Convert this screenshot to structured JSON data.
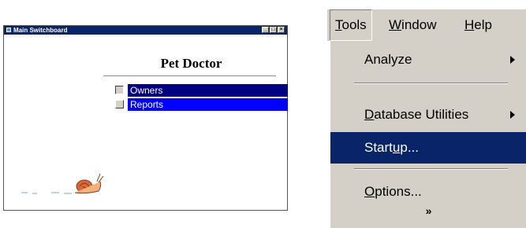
{
  "switchboard": {
    "window_title": "Main Switchboard",
    "heading": "Pet Doctor",
    "items": [
      {
        "label": "Owners"
      },
      {
        "label": "Reports"
      }
    ]
  },
  "menu": {
    "menubar": [
      {
        "label_u": "T",
        "label_rest": "ools"
      },
      {
        "label_u": "W",
        "label_rest": "indow"
      },
      {
        "label_u": "H",
        "label_rest": "elp"
      }
    ],
    "items": [
      {
        "pre": "Analyze",
        "u": "",
        "post": "",
        "label_full": "Analyze"
      },
      {
        "pre": "",
        "u": "D",
        "post": "atabase Utilities"
      },
      {
        "pre": "Start",
        "u": "u",
        "post": "p..."
      },
      {
        "pre": "",
        "u": "O",
        "post": "ptions..."
      }
    ],
    "expand_glyph": "»"
  },
  "colors": {
    "titlebar": "#0a246a",
    "owners_highlight": "#000080",
    "reports_highlight": "#0000ff",
    "menu_face": "#d4d0c8",
    "menu_highlight": "#0a246a"
  }
}
